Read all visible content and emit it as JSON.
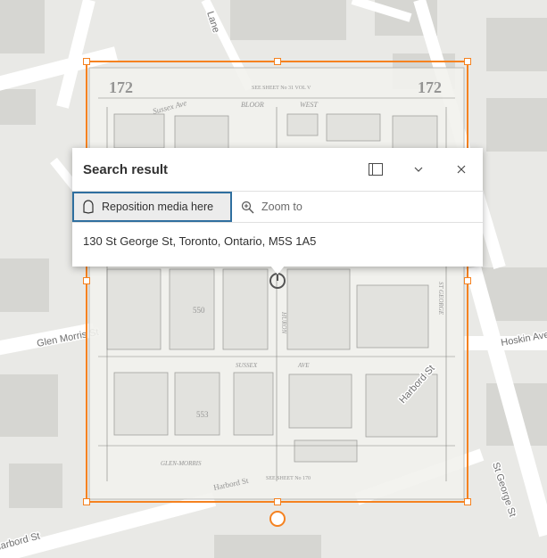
{
  "popup": {
    "title": "Search result",
    "reposition_label": "Reposition media here",
    "zoom_label": "Zoom to",
    "address": "130 St George St, Toronto, Ontario, M5S 1A5"
  },
  "map": {
    "streets": {
      "lane": "Lane",
      "glen_morris": "Glen Morris St",
      "hoskin": "Hoskin Ave",
      "st_george": "St George St",
      "harbord_bottom": "Harbord St",
      "harbord_top": "Harbord St"
    },
    "sheet": {
      "number_left": "172",
      "number_right": "172",
      "see_sheet_top": "SEE SHEET No 31 VOL V",
      "bloor": "BLOOR",
      "west": "WEST",
      "sussex_ave": "Sussex Ave",
      "sussex": "SUSSEX",
      "ave": "AVE",
      "huron": "HURON",
      "glen_morris": "GLEN-MORRIS",
      "st_george": "ST GEORGE",
      "see_sheet_bottom": "SEE SHEET No 170",
      "block_550": "550",
      "block_553": "553",
      "harbord_st": "Harbord St"
    }
  },
  "colors": {
    "accent": "#f58220",
    "focus": "#2f6f9f",
    "map_bg": "#e9e9e6",
    "building": "#d6d6d2",
    "road": "#ffffff"
  }
}
